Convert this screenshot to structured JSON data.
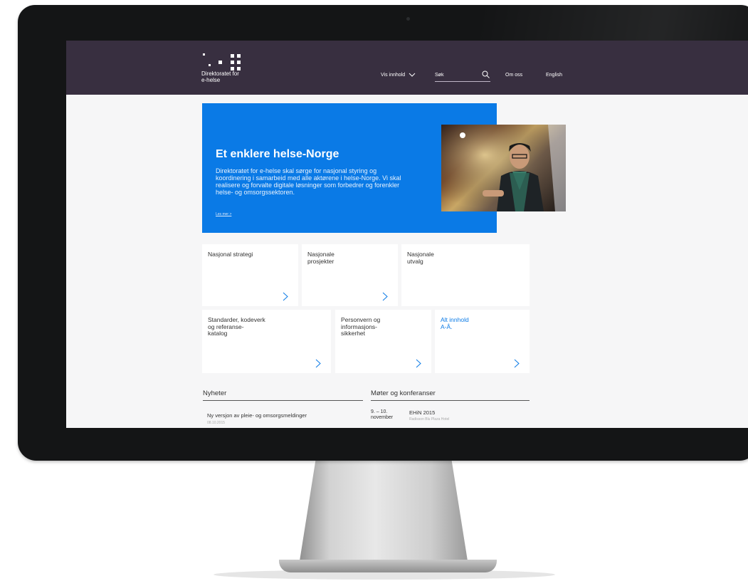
{
  "site": {
    "logo_text": "Direktoratet for\ne-helse",
    "nav": {
      "vis_innhold": "Vis innhold",
      "search_placeholder": "Søk",
      "om_oss": "Om oss",
      "english": "English"
    }
  },
  "hero": {
    "title": "Et enklere helse-Norge",
    "body": "Direktoratet for e-helse skal sørge for nasjonal styring og koordinering i samarbeid med alle aktørene i helse-Norge. Vi skal realisere og forvalte digitale løsninger som forbedrer og forenkler helse- og omsorgssektoren.",
    "link": "Les mer >"
  },
  "cards": [
    {
      "label": "Nasjonal strategi"
    },
    {
      "label": "Nasjonale\nprosjekter"
    },
    {
      "label": "Nasjonale\nutvalg"
    },
    {
      "label": "Standarder, kodeverk\nog referanse-\nkatalog"
    },
    {
      "label": "Personvern og\ninformasjons-\nsikkerhet"
    },
    {
      "label": "Alt innhold\nA-Å."
    }
  ],
  "news": {
    "heading": "Nyheter",
    "items": [
      {
        "title": "Ny versjon av pleie- og omsorgsmeldinger",
        "date": "08.10.2015"
      }
    ]
  },
  "events": {
    "heading": "Møter og konferanser",
    "items": [
      {
        "date": "9. – 10.\nnovember",
        "name": "EHiN 2015",
        "location": "Radisson Blu Plaza Hotel"
      }
    ]
  },
  "colors": {
    "header_bg": "#382f40",
    "accent_blue": "#0a7ae6",
    "page_bg": "#f6f6f7"
  }
}
